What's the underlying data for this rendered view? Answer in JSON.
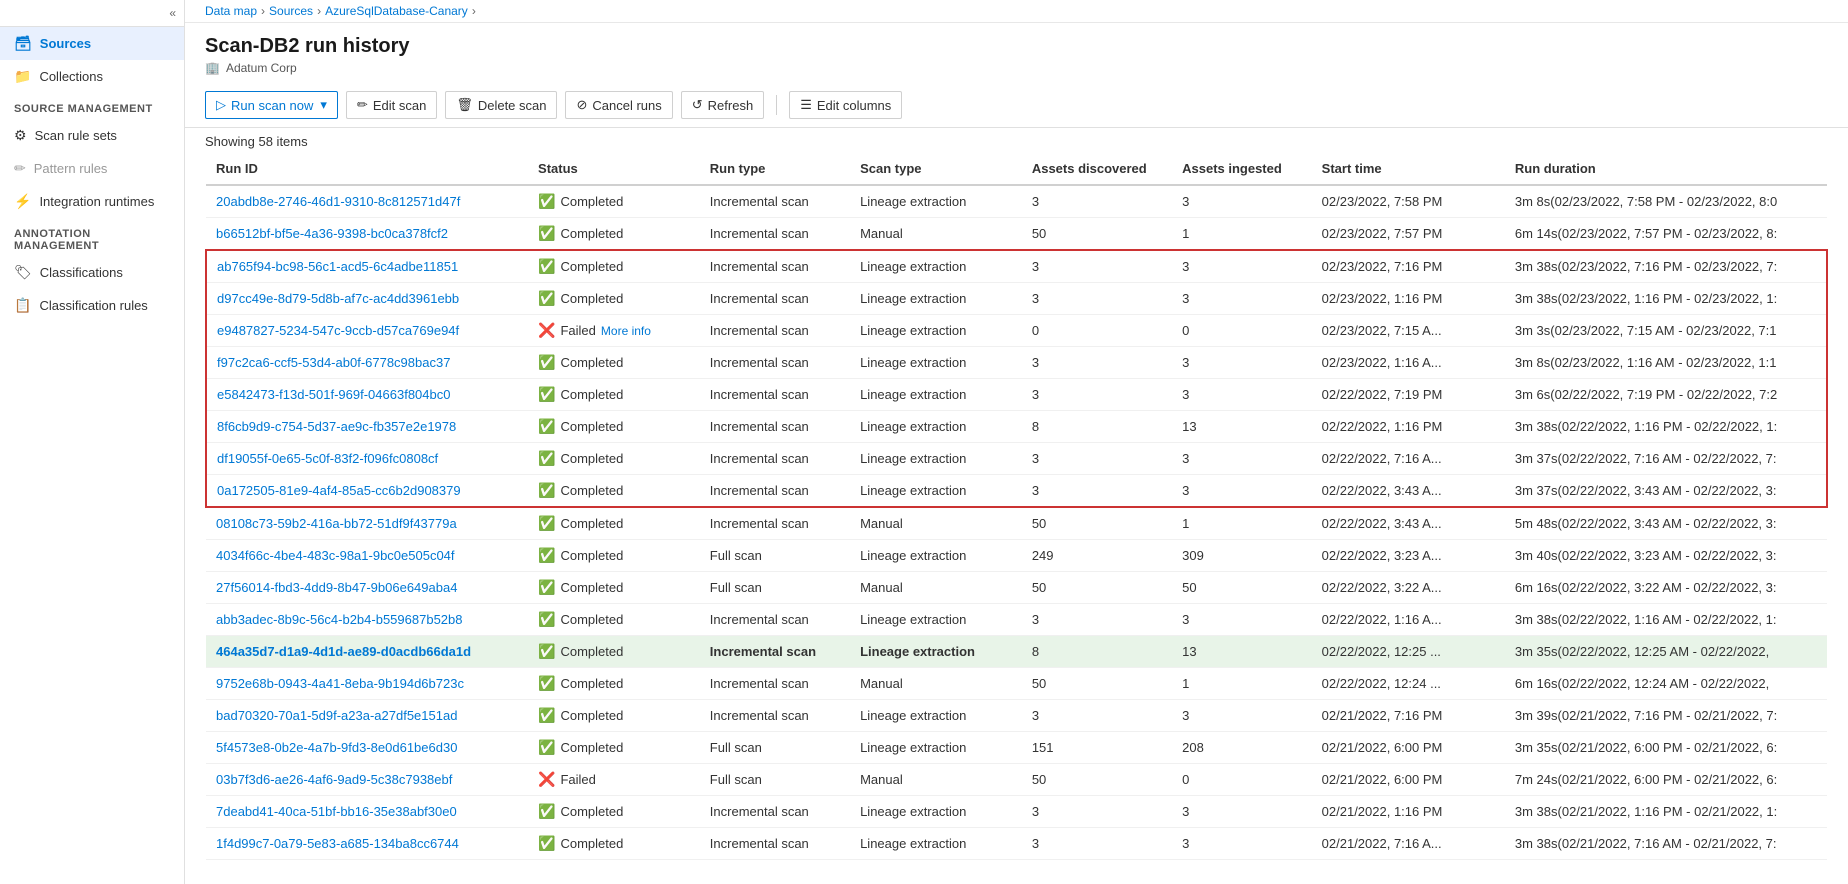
{
  "sidebar": {
    "collapse_hint": "«",
    "nav_items": [
      {
        "id": "sources",
        "label": "Sources",
        "icon": "🗃",
        "active": true
      },
      {
        "id": "collections",
        "label": "Collections",
        "icon": "📁",
        "active": false
      }
    ],
    "source_management_label": "Source management",
    "source_management_items": [
      {
        "id": "scan-rule-sets",
        "label": "Scan rule sets",
        "icon": "⚙"
      },
      {
        "id": "pattern-rules",
        "label": "Pattern rules",
        "icon": "✏",
        "disabled": true
      },
      {
        "id": "integration-runtimes",
        "label": "Integration runtimes",
        "icon": "⚡"
      }
    ],
    "annotation_management_label": "Annotation management",
    "annotation_management_items": [
      {
        "id": "classifications",
        "label": "Classifications",
        "icon": "🏷"
      },
      {
        "id": "classification-rules",
        "label": "Classification rules",
        "icon": "📋"
      }
    ]
  },
  "breadcrumb": {
    "items": [
      "Data map",
      "Sources",
      "AzureSqlDatabase-Canary"
    ]
  },
  "page": {
    "title": "Scan-DB2 run history",
    "subtitle": "Adatum Corp"
  },
  "toolbar": {
    "run_scan_label": "Run scan now",
    "edit_scan_label": "Edit scan",
    "delete_scan_label": "Delete scan",
    "cancel_runs_label": "Cancel runs",
    "refresh_label": "Refresh",
    "edit_columns_label": "Edit columns"
  },
  "table": {
    "showing_text": "Showing 58 items",
    "columns": [
      "Run ID",
      "Status",
      "Run type",
      "Scan type",
      "Assets discovered",
      "Assets ingested",
      "Start time",
      "Run duration"
    ],
    "rows": [
      {
        "id": "20abdb8e-2746-46d1-9310-8c812571d47f",
        "status": "Completed",
        "status_ok": true,
        "run_type": "Incremental scan",
        "scan_type": "Lineage extraction",
        "assets_disc": "3",
        "assets_ing": "3",
        "start": "02/23/2022, 7:58 PM",
        "duration": "3m 8s(02/23/2022, 7:58 PM - 02/23/2022, 8:0"
      },
      {
        "id": "b66512bf-bf5e-4a36-9398-bc0ca378fcf2",
        "status": "Completed",
        "status_ok": true,
        "run_type": "Incremental scan",
        "scan_type": "Manual",
        "assets_disc": "50",
        "assets_ing": "1",
        "start": "02/23/2022, 7:57 PM",
        "duration": "6m 14s(02/23/2022, 7:57 PM - 02/23/2022, 8:"
      },
      {
        "id": "ab765f94-bc98-56c1-acd5-6c4adbe11851",
        "status": "Completed",
        "status_ok": true,
        "run_type": "Incremental scan",
        "scan_type": "Lineage extraction",
        "assets_disc": "3",
        "assets_ing": "3",
        "start": "02/23/2022, 7:16 PM",
        "duration": "3m 38s(02/23/2022, 7:16 PM - 02/23/2022, 7:",
        "red_start": true
      },
      {
        "id": "d97cc49e-8d79-5d8b-af7c-ac4dd3961ebb",
        "status": "Completed",
        "status_ok": true,
        "run_type": "Incremental scan",
        "scan_type": "Lineage extraction",
        "assets_disc": "3",
        "assets_ing": "3",
        "start": "02/23/2022, 1:16 PM",
        "duration": "3m 38s(02/23/2022, 1:16 PM - 02/23/2022, 1:",
        "red_mid": true
      },
      {
        "id": "e9487827-5234-547c-9ccb-d57ca769e94f",
        "status": "Failed",
        "status_ok": false,
        "more_info": true,
        "run_type": "Incremental scan",
        "scan_type": "Lineage extraction",
        "assets_disc": "0",
        "assets_ing": "0",
        "start": "02/23/2022, 7:15 A...",
        "duration": "3m 3s(02/23/2022, 7:15 AM - 02/23/2022, 7:1",
        "red_mid": true
      },
      {
        "id": "f97c2ca6-ccf5-53d4-ab0f-6778c98bac37",
        "status": "Completed",
        "status_ok": true,
        "run_type": "Incremental scan",
        "scan_type": "Lineage extraction",
        "assets_disc": "3",
        "assets_ing": "3",
        "start": "02/23/2022, 1:16 A...",
        "duration": "3m 8s(02/23/2022, 1:16 AM - 02/23/2022, 1:1",
        "red_mid": true
      },
      {
        "id": "e5842473-f13d-501f-969f-04663f804bc0",
        "status": "Completed",
        "status_ok": true,
        "run_type": "Incremental scan",
        "scan_type": "Lineage extraction",
        "assets_disc": "3",
        "assets_ing": "3",
        "start": "02/22/2022, 7:19 PM",
        "duration": "3m 6s(02/22/2022, 7:19 PM - 02/22/2022, 7:2",
        "red_mid": true
      },
      {
        "id": "8f6cb9d9-c754-5d37-ae9c-fb357e2e1978",
        "status": "Completed",
        "status_ok": true,
        "run_type": "Incremental scan",
        "scan_type": "Lineage extraction",
        "assets_disc": "8",
        "assets_ing": "13",
        "start": "02/22/2022, 1:16 PM",
        "duration": "3m 38s(02/22/2022, 1:16 PM - 02/22/2022, 1:",
        "red_mid": true
      },
      {
        "id": "df19055f-0e65-5c0f-83f2-f096fc0808cf",
        "status": "Completed",
        "status_ok": true,
        "run_type": "Incremental scan",
        "scan_type": "Lineage extraction",
        "assets_disc": "3",
        "assets_ing": "3",
        "start": "02/22/2022, 7:16 A...",
        "duration": "3m 37s(02/22/2022, 7:16 AM - 02/22/2022, 7:",
        "red_mid": true
      },
      {
        "id": "0a172505-81e9-4af4-85a5-cc6b2d908379",
        "status": "Completed",
        "status_ok": true,
        "run_type": "Incremental scan",
        "scan_type": "Lineage extraction",
        "assets_disc": "3",
        "assets_ing": "3",
        "start": "02/22/2022, 3:43 A...",
        "duration": "3m 37s(02/22/2022, 3:43 AM - 02/22/2022, 3:",
        "red_end": true
      },
      {
        "id": "08108c73-59b2-416a-bb72-51df9f43779a",
        "status": "Completed",
        "status_ok": true,
        "run_type": "Incremental scan",
        "scan_type": "Manual",
        "assets_disc": "50",
        "assets_ing": "1",
        "start": "02/22/2022, 3:43 A...",
        "duration": "5m 48s(02/22/2022, 3:43 AM - 02/22/2022, 3:"
      },
      {
        "id": "4034f66c-4be4-483c-98a1-9bc0e505c04f",
        "status": "Completed",
        "status_ok": true,
        "run_type": "Full scan",
        "scan_type": "Lineage extraction",
        "assets_disc": "249",
        "assets_ing": "309",
        "start": "02/22/2022, 3:23 A...",
        "duration": "3m 40s(02/22/2022, 3:23 AM - 02/22/2022, 3:"
      },
      {
        "id": "27f56014-fbd3-4dd9-8b47-9b06e649aba4",
        "status": "Completed",
        "status_ok": true,
        "run_type": "Full scan",
        "scan_type": "Manual",
        "assets_disc": "50",
        "assets_ing": "50",
        "start": "02/22/2022, 3:22 A...",
        "duration": "6m 16s(02/22/2022, 3:22 AM - 02/22/2022, 3:"
      },
      {
        "id": "abb3adec-8b9c-56c4-b2b4-b559687b52b8",
        "status": "Completed",
        "status_ok": true,
        "run_type": "Incremental scan",
        "scan_type": "Lineage extraction",
        "assets_disc": "3",
        "assets_ing": "3",
        "start": "02/22/2022, 1:16 A...",
        "duration": "3m 38s(02/22/2022, 1:16 AM - 02/22/2022, 1:"
      },
      {
        "id": "464a35d7-d1a9-4d1d-ae89-d0acdb66da1d",
        "status": "Completed",
        "status_ok": true,
        "run_type": "Incremental scan",
        "scan_type": "Lineage extraction",
        "assets_disc": "8",
        "assets_ing": "13",
        "start": "02/22/2022, 12:25 ...",
        "duration": "3m 35s(02/22/2022, 12:25 AM - 02/22/2022,",
        "highlighted": true
      },
      {
        "id": "9752e68b-0943-4a41-8eba-9b194d6b723c",
        "status": "Completed",
        "status_ok": true,
        "run_type": "Incremental scan",
        "scan_type": "Manual",
        "assets_disc": "50",
        "assets_ing": "1",
        "start": "02/22/2022, 12:24 ...",
        "duration": "6m 16s(02/22/2022, 12:24 AM - 02/22/2022,"
      },
      {
        "id": "bad70320-70a1-5d9f-a23a-a27df5e151ad",
        "status": "Completed",
        "status_ok": true,
        "run_type": "Incremental scan",
        "scan_type": "Lineage extraction",
        "assets_disc": "3",
        "assets_ing": "3",
        "start": "02/21/2022, 7:16 PM",
        "duration": "3m 39s(02/21/2022, 7:16 PM - 02/21/2022, 7:"
      },
      {
        "id": "5f4573e8-0b2e-4a7b-9fd3-8e0d61be6d30",
        "status": "Completed",
        "status_ok": true,
        "run_type": "Full scan",
        "scan_type": "Lineage extraction",
        "assets_disc": "151",
        "assets_ing": "208",
        "start": "02/21/2022, 6:00 PM",
        "duration": "3m 35s(02/21/2022, 6:00 PM - 02/21/2022, 6:"
      },
      {
        "id": "03b7f3d6-ae26-4af6-9ad9-5c38c7938ebf",
        "status": "Failed",
        "status_ok": false,
        "run_type": "Full scan",
        "scan_type": "Manual",
        "assets_disc": "50",
        "assets_ing": "0",
        "start": "02/21/2022, 6:00 PM",
        "duration": "7m 24s(02/21/2022, 6:00 PM - 02/21/2022, 6:"
      },
      {
        "id": "7deabd41-40ca-51bf-bb16-35e38abf30e0",
        "status": "Completed",
        "status_ok": true,
        "run_type": "Incremental scan",
        "scan_type": "Lineage extraction",
        "assets_disc": "3",
        "assets_ing": "3",
        "start": "02/21/2022, 1:16 PM",
        "duration": "3m 38s(02/21/2022, 1:16 PM - 02/21/2022, 1:"
      },
      {
        "id": "1f4d99c7-0a79-5e83-a685-134ba8cc6744",
        "status": "Completed",
        "status_ok": true,
        "run_type": "Incremental scan",
        "scan_type": "Lineage extraction",
        "assets_disc": "3",
        "assets_ing": "3",
        "start": "02/21/2022, 7:16 A...",
        "duration": "3m 38s(02/21/2022, 7:16 AM - 02/21/2022, 7:"
      }
    ]
  }
}
